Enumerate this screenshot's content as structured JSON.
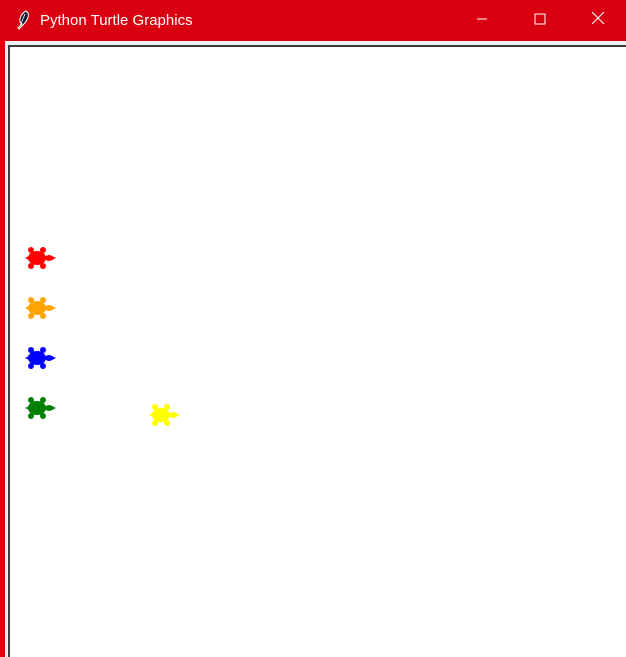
{
  "window": {
    "title": "Python Turtle Graphics",
    "app_icon": "feather-icon",
    "controls": {
      "minimize_icon": "minimize-icon",
      "maximize_icon": "maximize-icon",
      "close_icon": "close-icon"
    },
    "accent_color": "#d80010"
  },
  "canvas": {
    "background": "#ffffff",
    "turtles": [
      {
        "name": "turtle-red",
        "color": "red"
      },
      {
        "name": "turtle-orange",
        "color": "orange"
      },
      {
        "name": "turtle-blue",
        "color": "blue"
      },
      {
        "name": "turtle-green",
        "color": "green"
      },
      {
        "name": "turtle-yellow",
        "color": "yellow"
      }
    ]
  }
}
